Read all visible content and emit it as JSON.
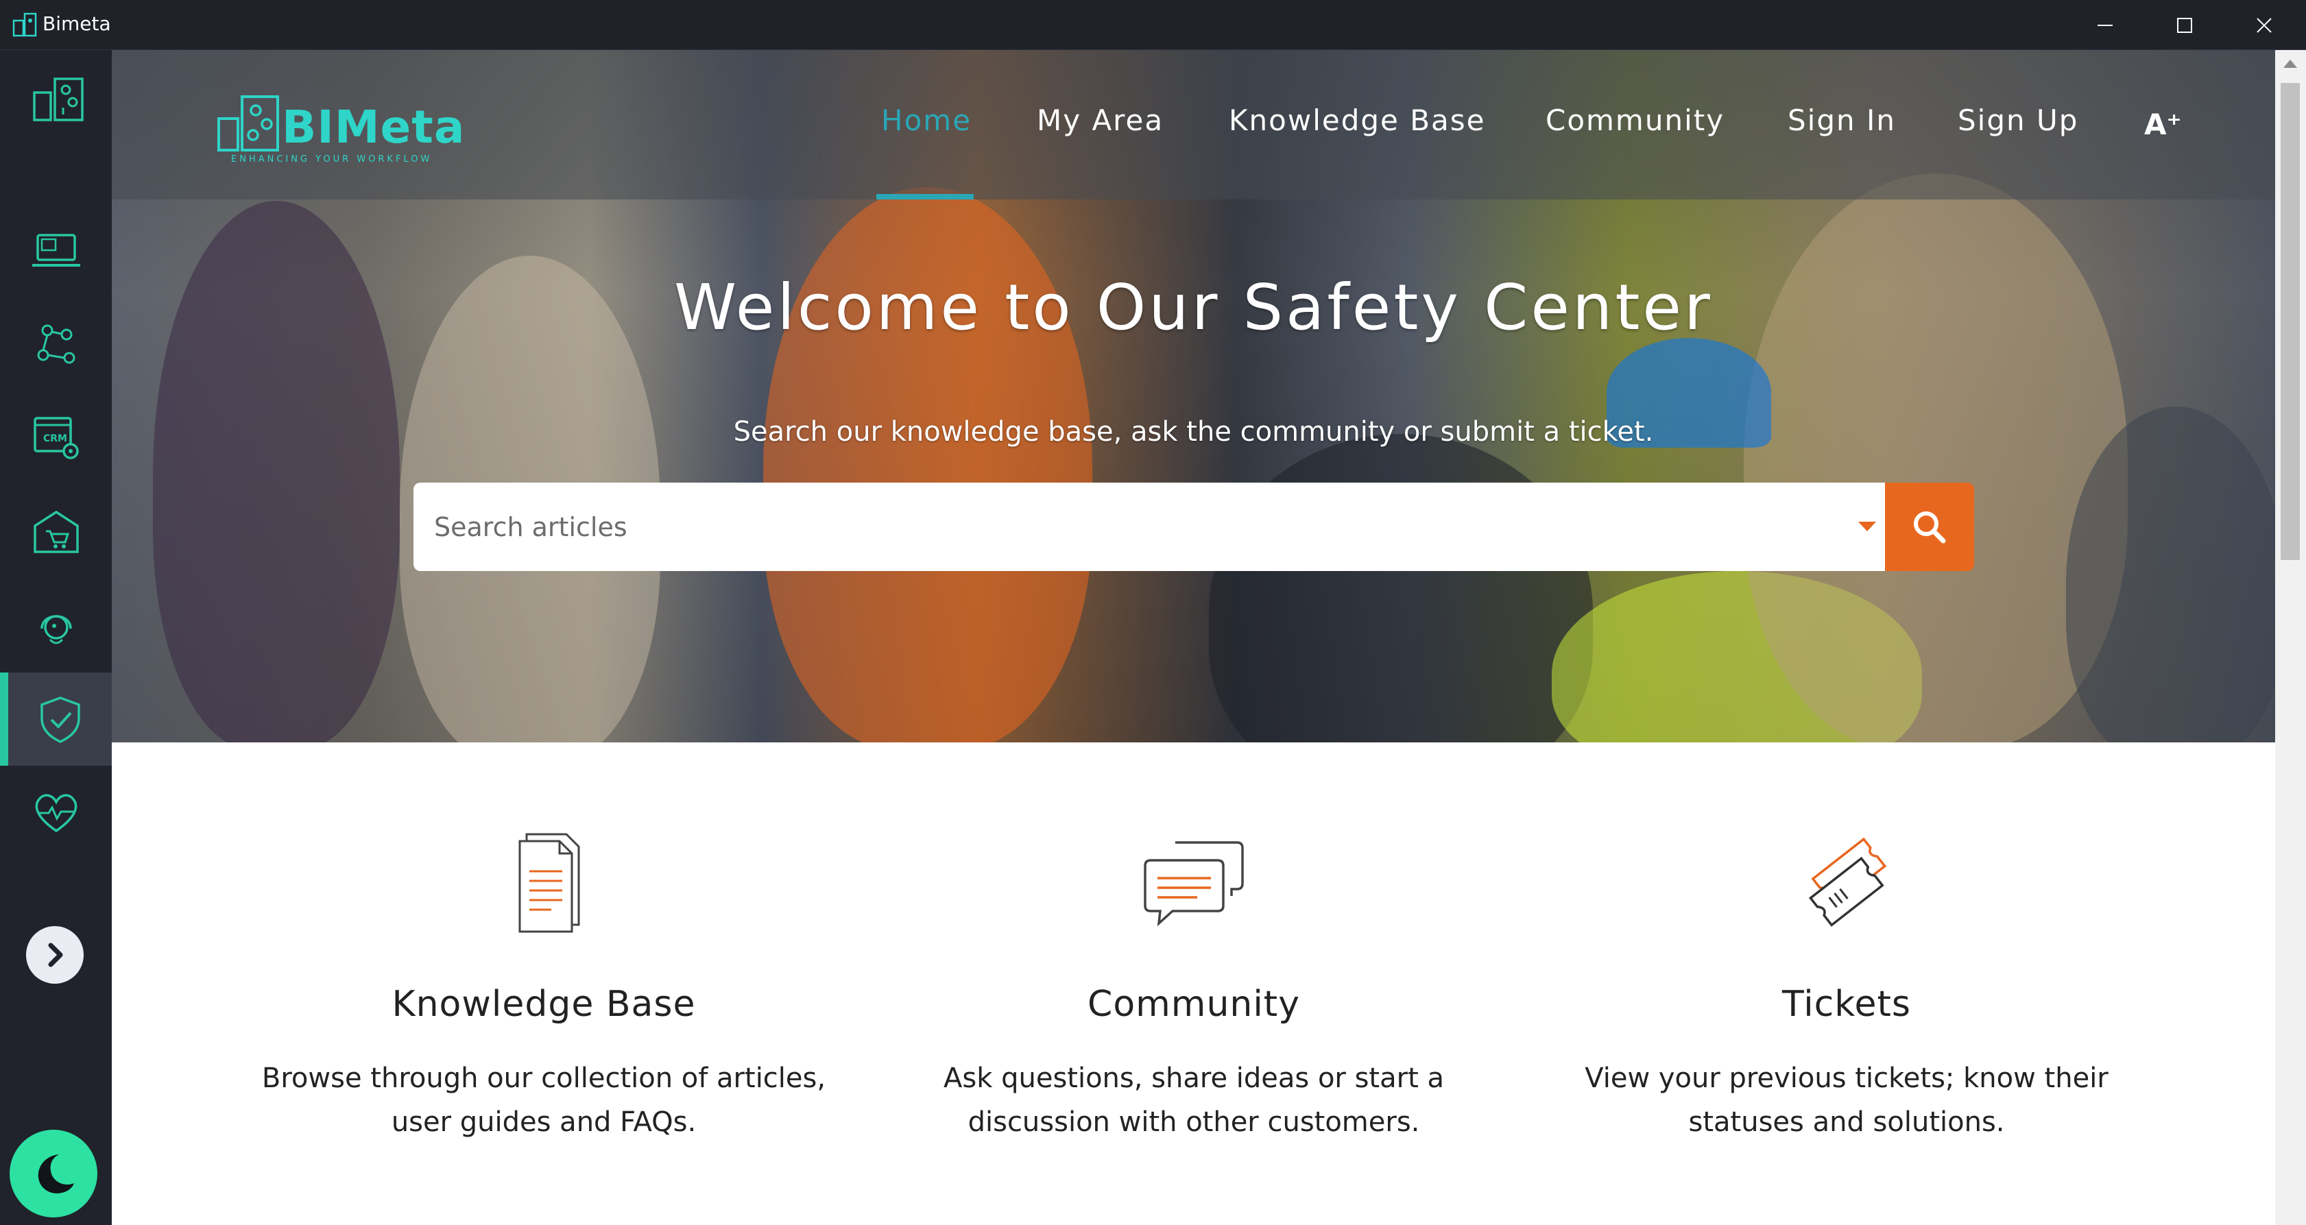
{
  "window": {
    "title": "Bimeta"
  },
  "brand": {
    "name": "BIMeta",
    "tagline": "ENHANCING YOUR WORKFLOW"
  },
  "nav": {
    "items": [
      {
        "label": "Home",
        "active": true
      },
      {
        "label": "My Area"
      },
      {
        "label": "Knowledge Base"
      },
      {
        "label": "Community"
      },
      {
        "label": "Sign In"
      },
      {
        "label": "Sign Up"
      }
    ],
    "font_icon": "A⁺"
  },
  "rail": {
    "icons": [
      "projects-icon",
      "laptop-icon",
      "network-icon",
      "crm-settings-icon",
      "store-icon",
      "support-agent-icon",
      "safety-shield-icon",
      "health-heart-icon"
    ],
    "active": "safety-shield-icon"
  },
  "hero": {
    "title": "Welcome to Our Safety Center",
    "subtitle": "Search our knowledge base, ask the community or submit a ticket."
  },
  "search": {
    "placeholder": "Search articles",
    "value": ""
  },
  "features": [
    {
      "title": "Knowledge Base",
      "desc_line1": "Browse through our collection of articles,",
      "desc_line2": "user guides and FAQs.",
      "icon": "document-icon"
    },
    {
      "title": "Community",
      "desc_line1": "Ask questions, share ideas or start a",
      "desc_line2": "discussion with other customers.",
      "icon": "chat-icon"
    },
    {
      "title": "Tickets",
      "desc_line1": "View your previous tickets; know their",
      "desc_line2": "statuses and solutions.",
      "icon": "ticket-icon"
    }
  ],
  "colors": {
    "accent": "#e8671f",
    "teal": "#2aa7b6",
    "rail_accent": "#28c7a2",
    "theme_toggle": "#2de1a3"
  }
}
